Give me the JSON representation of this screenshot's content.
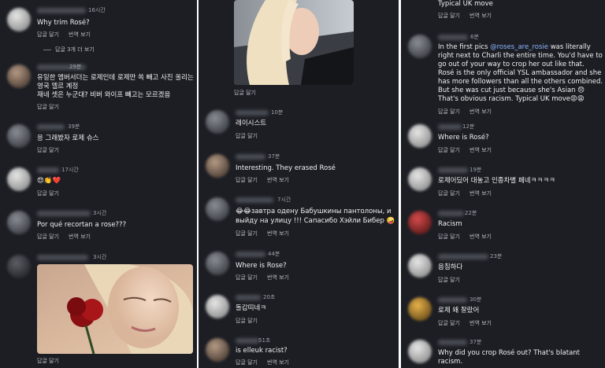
{
  "actions": {
    "reply": "답글 달기",
    "translate": "번역 보기"
  },
  "col1": [
    {
      "time": "16시간",
      "text": [
        "Why trim Rosé?"
      ],
      "translate": true,
      "replies": "답글 3개 더 보기"
    },
    {
      "time": "29분",
      "text": [
        "유일한 엠버서더는 로제인데 로제만 쏙 빼고 사진 올리는",
        "영국 엘르 계정",
        "재네 셋은 누군대? 비버 와이프 빼고는 모르겠음"
      ],
      "translate": false
    },
    {
      "time": "39분",
      "text": [
        "응 그래봤자 로제 슈스"
      ],
      "translate": false
    },
    {
      "time": "17시간",
      "text": [
        "😍👏❤️"
      ],
      "translate": false
    },
    {
      "time": "3시간",
      "text": [
        "Por qué recortan a rose???"
      ],
      "translate": true
    },
    {
      "time": "3시간",
      "text": [],
      "photo": true,
      "translate": false
    }
  ],
  "col2": [
    {
      "time": "10분",
      "text": [
        "레이시스트"
      ],
      "translate": false
    },
    {
      "time": "37분",
      "text": [
        "Interesting. They erased Rosé"
      ],
      "translate": true
    },
    {
      "time": "7시간",
      "text": [
        "😂😂завтра одену Бабушкины пантолоны, и",
        "выйду на улицу !!! Сапасибо Хэйли Бибер 🤪"
      ],
      "translate": true
    },
    {
      "time": "44분",
      "text": [
        "Where is Rose?"
      ],
      "translate": true
    },
    {
      "time": "20초",
      "text": [
        "돌갑띠네ㅋ"
      ],
      "translate": false
    },
    {
      "time": "51초",
      "text": [
        "is elleuk racist?"
      ],
      "translate": true
    }
  ],
  "col3": [
    {
      "time": "",
      "text": [
        "Typical UK move"
      ],
      "translate": true
    },
    {
      "time": "6분",
      "mention": "@roses_are_rosie",
      "text": [
        "In the first pics ",
        "right next to Charli the entire time. You'd have to",
        "go out of your way to crop her out like that.",
        "Rosé is the only official YSL ambassador and she",
        "has more followers than all the others combined.",
        "But she was cut just because she's Asian 😞",
        "That's obvious racism. Typical UK move😡😩"
      ],
      "text_after_mention": " was literally",
      "translate": true
    },
    {
      "time": "12분",
      "text": [
        "Where is Rosé?"
      ],
      "translate": true
    },
    {
      "time": "19분",
      "text": [
        "로제어딨어 대놓고 인종차별 페네ㅋㅋㅋㅋ"
      ],
      "translate": true
    },
    {
      "time": "22분",
      "text": [
        "Racism"
      ],
      "translate": true
    },
    {
      "time": "23분",
      "text": [
        "음침하다"
      ],
      "translate": false
    },
    {
      "time": "30분",
      "text": [
        "로제 왜 잘랐어"
      ],
      "translate": true
    },
    {
      "time": "37분",
      "text": [
        "Why did you crop Rosé out? That's blatant",
        "racism."
      ],
      "translate": false
    }
  ]
}
